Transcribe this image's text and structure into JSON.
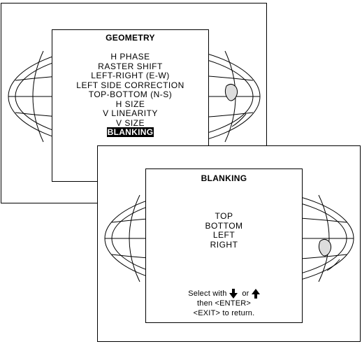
{
  "geometry_menu": {
    "title": "GEOMETRY",
    "items": [
      "H PHASE",
      "RASTER SHIFT",
      "LEFT-RIGHT (E-W)",
      "LEFT SIDE CORRECTION",
      "TOP-BOTTOM (N-S)",
      "H SIZE",
      "V LINEARITY",
      "V SIZE",
      "BLANKING"
    ],
    "selected": "BLANKING"
  },
  "blanking_menu": {
    "title": "BLANKING",
    "items": [
      "TOP",
      "BOTTOM",
      "LEFT",
      "RIGHT"
    ],
    "help_select_prefix": "Select with",
    "help_select_or": "or",
    "help_enter": "then <ENTER>",
    "help_exit": "<EXIT> to return.",
    "icons": [
      "arrow-down-icon",
      "arrow-up-icon"
    ]
  }
}
